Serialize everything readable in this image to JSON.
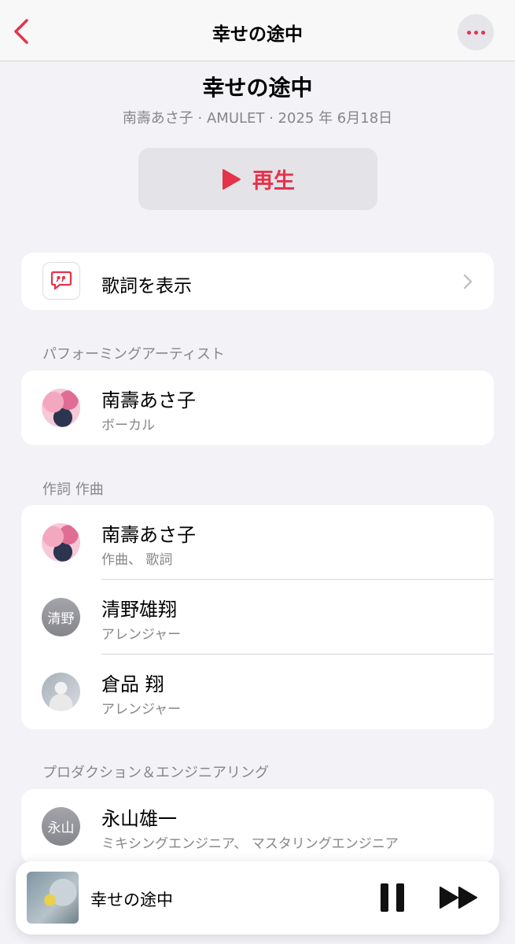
{
  "navbar": {
    "title": "幸せの途中",
    "back_icon": "chevron-left-icon",
    "more_icon": "ellipsis-icon"
  },
  "header": {
    "title": "幸せの途中",
    "subtitle": "南壽あさ子 · AMULET · 2025 年 6月18日",
    "play_label": "再生",
    "play_icon": "play-icon"
  },
  "lyrics": {
    "label": "歌詞を表示",
    "icon": "quote-bubble-icon"
  },
  "sections": {
    "performing": {
      "heading": "パフォーミングアーティスト",
      "rows": [
        {
          "name": "南壽あさ子",
          "role": "ボーカル"
        }
      ]
    },
    "writing": {
      "heading": "作詞 作曲",
      "rows": [
        {
          "name": "南壽あさ子",
          "role": "作曲、 歌詞"
        },
        {
          "name": "清野雄翔",
          "role": "アレンジャー",
          "avatar_text": "清野"
        },
        {
          "name": "倉品 翔",
          "role": "アレンジャー"
        }
      ]
    },
    "production": {
      "heading": "プロダクション＆エンジニアリング",
      "rows": [
        {
          "name": "永山雄一",
          "role": "ミキシングエンジニア、 マスタリングエンジニア",
          "avatar_text": "永山"
        }
      ]
    }
  },
  "mini_player": {
    "title": "幸せの途中",
    "pause_icon": "pause-icon",
    "forward_icon": "fast-forward-icon"
  },
  "colors": {
    "accent": "#e5334b",
    "background": "#f2f2f7",
    "secondary_text": "#86868b"
  }
}
